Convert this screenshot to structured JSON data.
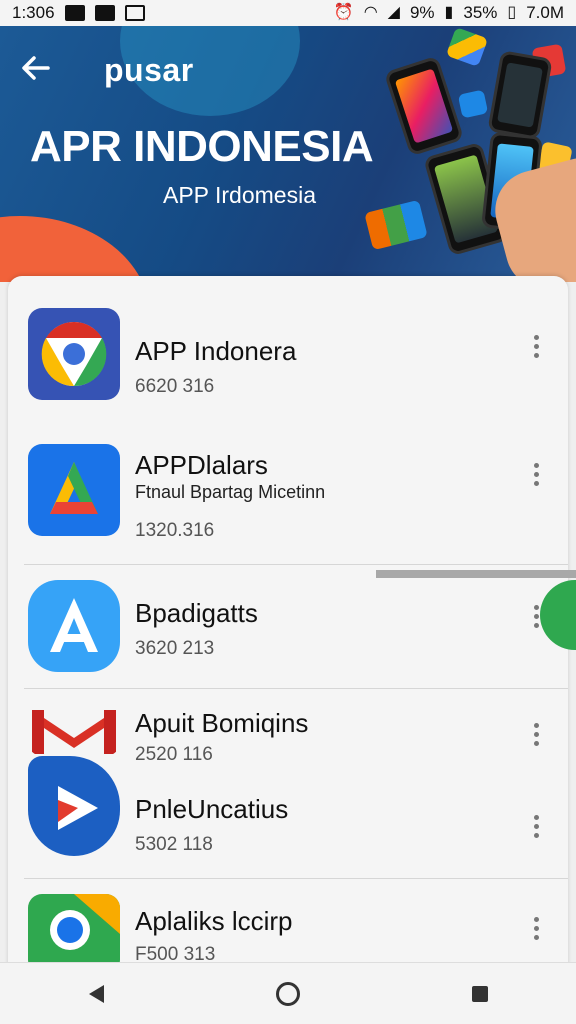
{
  "status_bar": {
    "time": "1:306",
    "battery_text": "9%",
    "percent_text": "35%",
    "data_text": "7.0M"
  },
  "header": {
    "back_icon": "arrow-left-icon",
    "title": "pusar",
    "banner_heading": "APR INDONESIA",
    "banner_subheading": "APP Irdomesia"
  },
  "apps": [
    {
      "icon": "chrome-icon",
      "title": "APP Indonera",
      "subtitle": "",
      "meta": "6620 316",
      "colors": [
        "#3653b4",
        "#d93025",
        "#fbbc04",
        "#34a853"
      ]
    },
    {
      "icon": "drive-icon",
      "title": "APPDlalars",
      "subtitle": "Ftnaul Bpartag Micetinn",
      "meta": "1320.316",
      "colors": [
        "#1a73e8",
        "#fbbc04",
        "#34a853",
        "#ea4335"
      ]
    },
    {
      "icon": "app-store-icon",
      "title": "Bpadigatts",
      "subtitle": "",
      "meta": "3620 213",
      "colors": [
        "#36a3f7"
      ]
    },
    {
      "icon": "gmail-icon",
      "title": "Apuit Bomiqins",
      "subtitle": "",
      "meta": "2520 116",
      "colors": [
        "#d93025"
      ]
    },
    {
      "icon": "play-icon",
      "title": "PnleUncatius",
      "subtitle": "",
      "meta": "5302 118",
      "colors": [
        "#1c5fc2",
        "#e23b2e"
      ]
    },
    {
      "icon": "chrome-green-icon",
      "title": "Aplaliks lccirp",
      "subtitle": "",
      "meta": "F500 313",
      "colors": [
        "#2fa84f",
        "#f9ab00",
        "#1a73e8"
      ]
    }
  ],
  "nav": {
    "back": "nav-back-icon",
    "home": "nav-home-icon",
    "recent": "nav-recent-icon"
  }
}
